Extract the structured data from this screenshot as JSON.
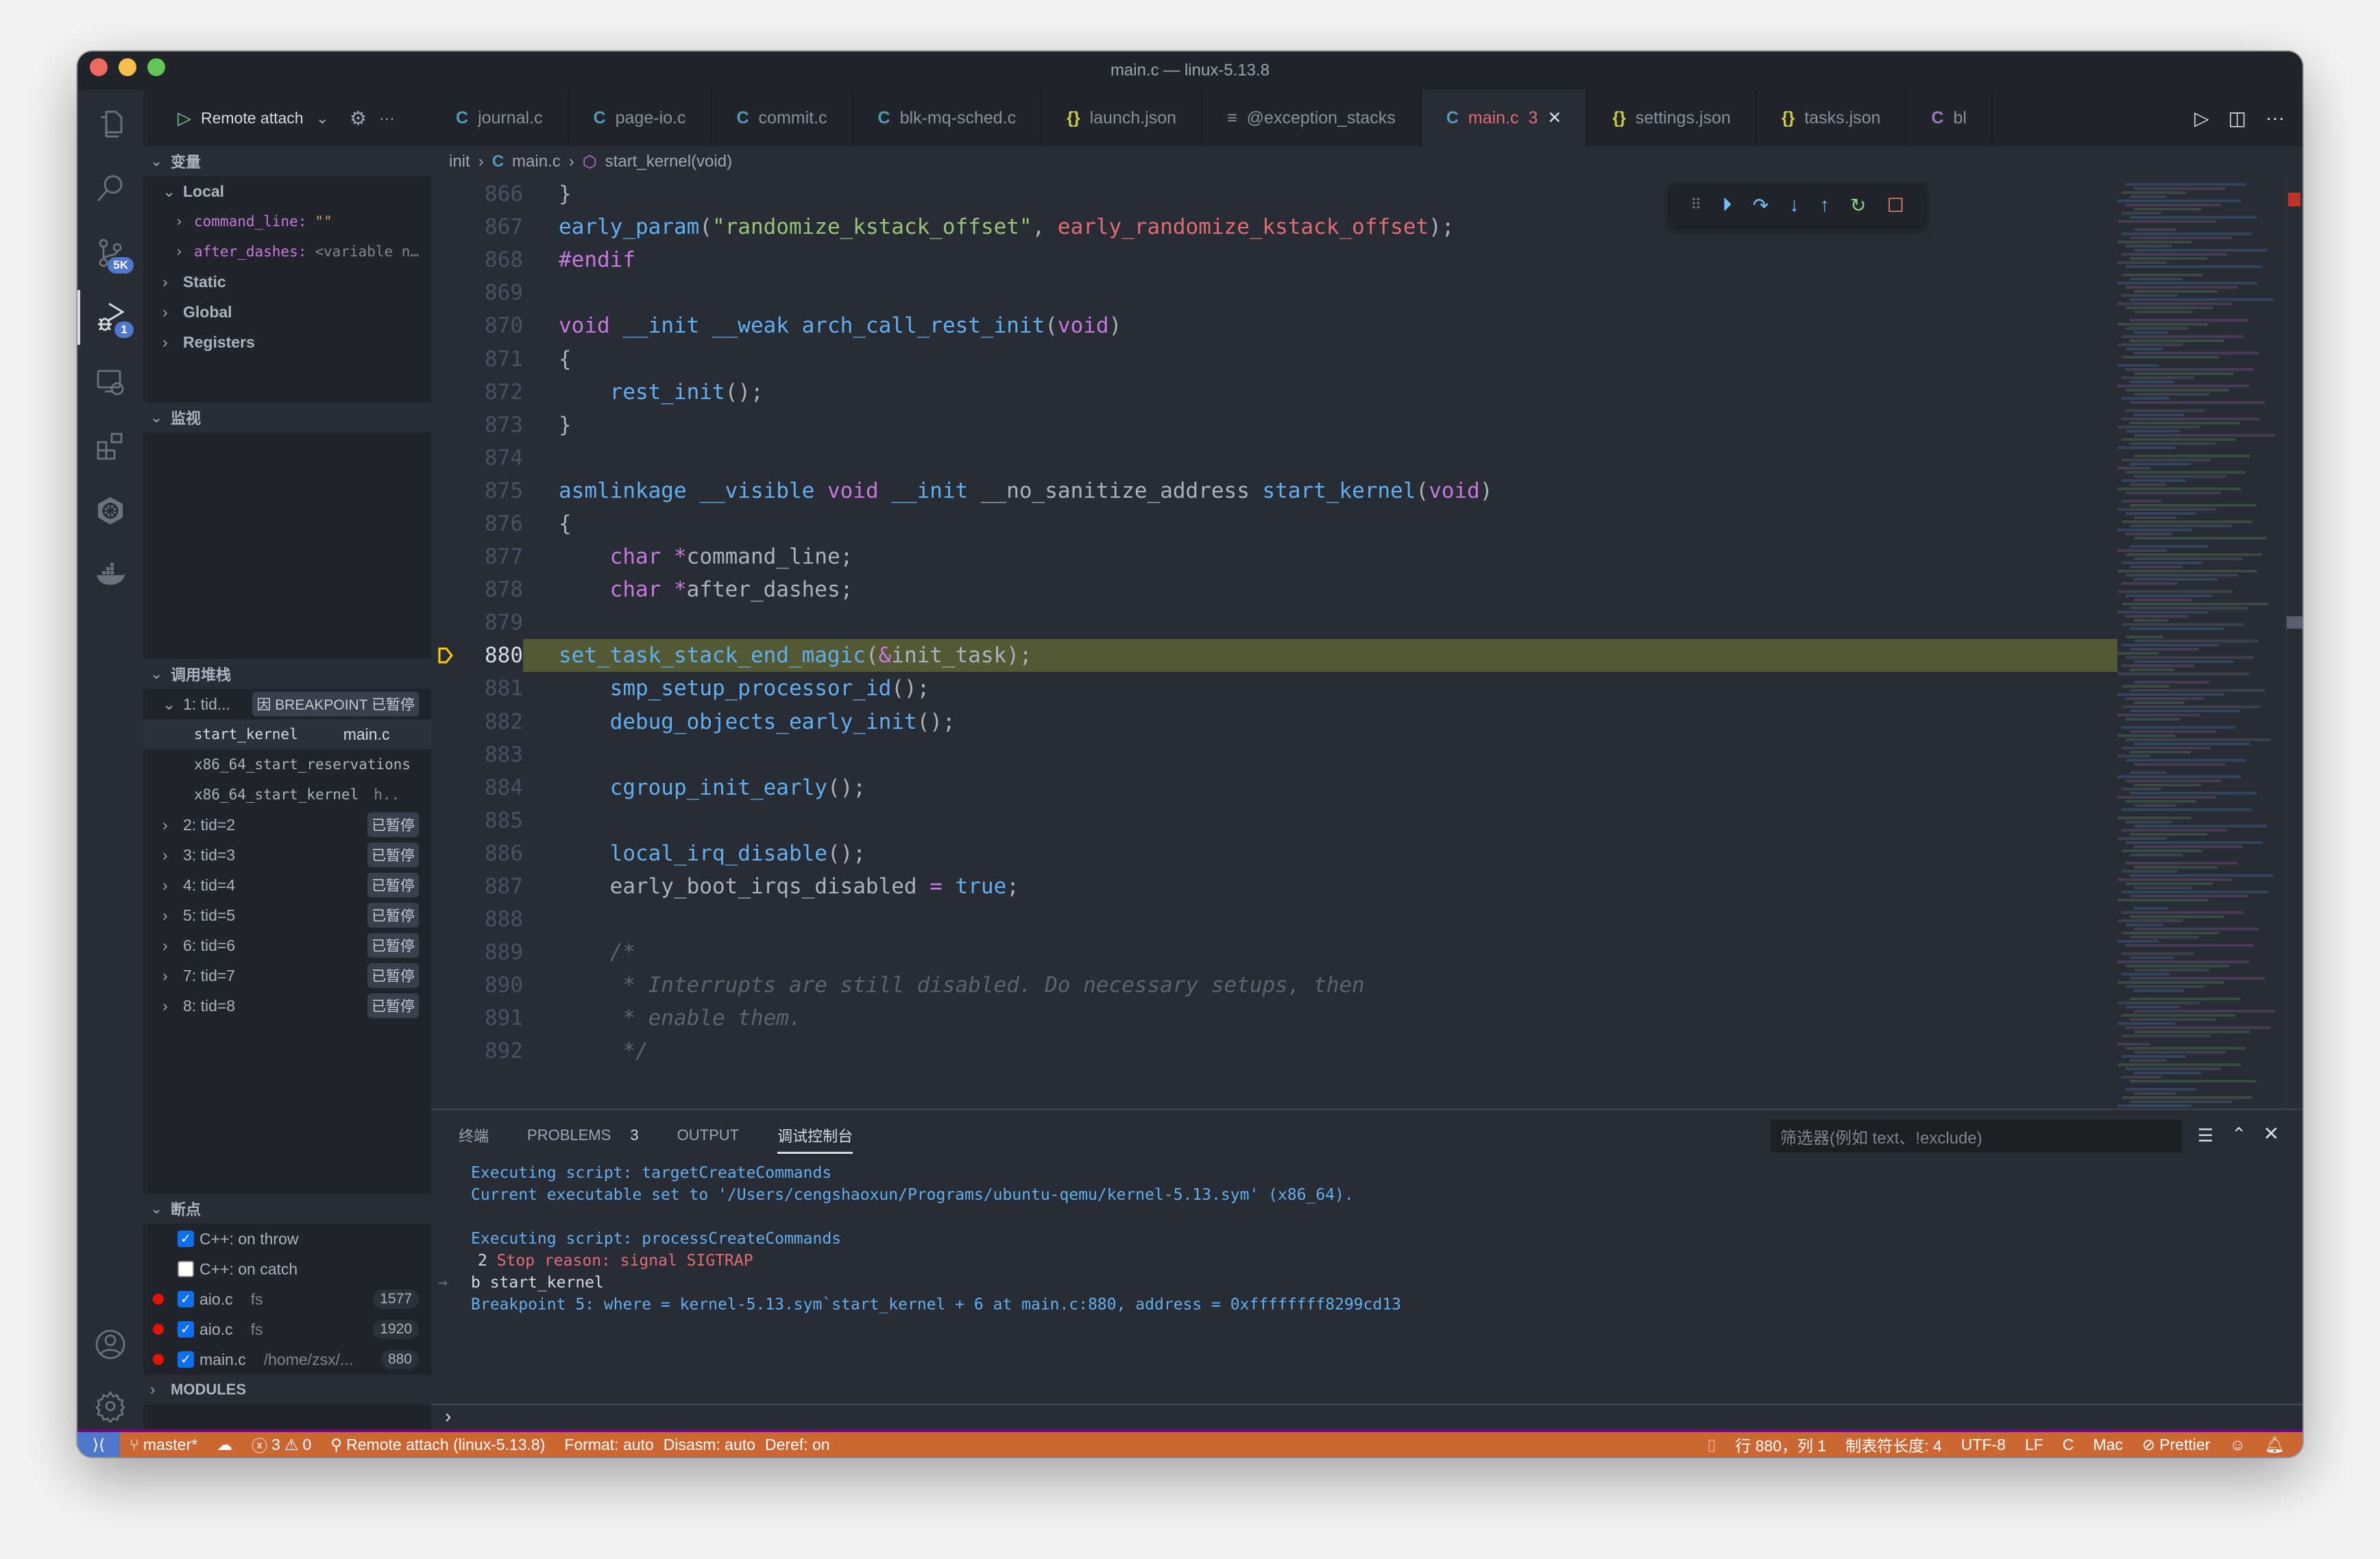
{
  "window": {
    "title": "main.c — linux-5.13.8"
  },
  "activity_bar": {
    "items": [
      {
        "name": "explorer",
        "badge": null
      },
      {
        "name": "search",
        "badge": null
      },
      {
        "name": "source-control",
        "badge": "5K"
      },
      {
        "name": "run-debug",
        "badge": "1",
        "active": true
      },
      {
        "name": "remote-explorer",
        "badge": null
      },
      {
        "name": "extensions",
        "badge": null
      },
      {
        "name": "kubernetes",
        "badge": null
      },
      {
        "name": "docker",
        "badge": null
      }
    ],
    "bottom": [
      "accounts",
      "manage"
    ]
  },
  "debug_header": {
    "config": "Remote attach"
  },
  "variables": {
    "title": "变量",
    "local_label": "Local",
    "locals": [
      {
        "name": "command_line:",
        "value": "\"\""
      },
      {
        "name": "after_dashes:",
        "value": "<variable n…"
      }
    ],
    "scopes": [
      "Static",
      "Global",
      "Registers"
    ]
  },
  "watch": {
    "title": "监视"
  },
  "callstack": {
    "title": "调用堆栈",
    "thread1": {
      "label": "1: tid...",
      "status": "因 BREAKPOINT 已暂停"
    },
    "frames": [
      {
        "name": "start_kernel",
        "file": "main.c"
      },
      {
        "name": "x86_64_start_reservations",
        "file": ""
      },
      {
        "name": "x86_64_start_kernel",
        "file": "h.."
      }
    ],
    "threads": [
      {
        "label": "2: tid=2",
        "status": "已暂停"
      },
      {
        "label": "3: tid=3",
        "status": "已暂停"
      },
      {
        "label": "4: tid=4",
        "status": "已暂停"
      },
      {
        "label": "5: tid=5",
        "status": "已暂停"
      },
      {
        "label": "6: tid=6",
        "status": "已暂停"
      },
      {
        "label": "7: tid=7",
        "status": "已暂停"
      },
      {
        "label": "8: tid=8",
        "status": "已暂停"
      }
    ]
  },
  "breakpoints": {
    "title": "断点",
    "items": [
      {
        "label": "C++: on throw",
        "path": "",
        "line": "",
        "checked": true,
        "dot": false
      },
      {
        "label": "C++: on catch",
        "path": "",
        "line": "",
        "checked": false,
        "dot": false
      },
      {
        "label": "aio.c",
        "path": "fs",
        "line": "1577",
        "checked": true,
        "dot": true
      },
      {
        "label": "aio.c",
        "path": "fs",
        "line": "1920",
        "checked": true,
        "dot": true
      },
      {
        "label": "main.c",
        "path": "/home/zsx/...",
        "line": "880",
        "checked": true,
        "dot": true
      }
    ]
  },
  "modules": {
    "title": "MODULES"
  },
  "tabs": [
    {
      "icon": "C",
      "label": "journal.c"
    },
    {
      "icon": "C",
      "label": "page-io.c"
    },
    {
      "icon": "C",
      "label": "commit.c"
    },
    {
      "icon": "C",
      "label": "blk-mq-sched.c"
    },
    {
      "icon": "{}",
      "label": "launch.json"
    },
    {
      "icon": "≡",
      "label": "@exception_stacks"
    },
    {
      "icon": "C",
      "label": "main.c",
      "problems": "3",
      "active": true
    },
    {
      "icon": "{}",
      "label": "settings.json"
    },
    {
      "icon": "{}",
      "label": "tasks.json"
    },
    {
      "icon": "C",
      "label": "bl"
    }
  ],
  "breadcrumb": [
    "init",
    "main.c",
    "start_kernel(void)"
  ],
  "code": {
    "current_line": 880,
    "lines": [
      {
        "n": "866",
        "html": "}"
      },
      {
        "n": "867",
        "html": "<span class='f'>early_param</span>(<span class='s'>\"randomize_kstack_offset\"</span>, <span class='r'>early_randomize_kstack_offset</span>);"
      },
      {
        "n": "868",
        "html": "<span class='k'>#endif</span>"
      },
      {
        "n": "869",
        "html": ""
      },
      {
        "n": "870",
        "html": "<span class='k'>void</span> <span class='f'>__init</span> <span class='f'>__weak</span> <span class='f'>arch_call_rest_init</span>(<span class='k'>void</span>)"
      },
      {
        "n": "871",
        "html": "{"
      },
      {
        "n": "872",
        "html": "    <span class='f'>rest_init</span>();"
      },
      {
        "n": "873",
        "html": "}"
      },
      {
        "n": "874",
        "html": ""
      },
      {
        "n": "875",
        "html": "<span class='f'>asmlinkage</span> <span class='f'>__visible</span> <span class='k'>void</span> <span class='f'>__init</span> __no_sanitize_address <span class='f'>start_kernel</span>(<span class='k'>void</span>)"
      },
      {
        "n": "876",
        "html": "{"
      },
      {
        "n": "877",
        "html": "    <span class='k'>char</span> <span class='k'>*</span>command_line;"
      },
      {
        "n": "878",
        "html": "    <span class='k'>char</span> <span class='k'>*</span>after_dashes;"
      },
      {
        "n": "879",
        "html": ""
      },
      {
        "n": "880",
        "html": "    <span class='f'>set_task_stack_end_magic</span>(<span class='k'>&amp;</span>init_task);"
      },
      {
        "n": "881",
        "html": "    <span class='f'>smp_setup_processor_id</span>();"
      },
      {
        "n": "882",
        "html": "    <span class='f'>debug_objects_early_init</span>();"
      },
      {
        "n": "883",
        "html": ""
      },
      {
        "n": "884",
        "html": "    <span class='f'>cgroup_init_early</span>();"
      },
      {
        "n": "885",
        "html": ""
      },
      {
        "n": "886",
        "html": "    <span class='f'>local_irq_disable</span>();"
      },
      {
        "n": "887",
        "html": "    early_boot_irqs_disabled <span class='k'>=</span> <span class='f'>true</span>;"
      },
      {
        "n": "888",
        "html": ""
      },
      {
        "n": "889",
        "html": "    <span class='c'>/*</span>"
      },
      {
        "n": "890",
        "html": "<span class='c'>     * Interrupts are still disabled. Do necessary setups, then</span>"
      },
      {
        "n": "891",
        "html": "<span class='c'>     * enable them.</span>"
      },
      {
        "n": "892",
        "html": "<span class='c'>     */</span>"
      }
    ]
  },
  "panel": {
    "tabs": [
      {
        "label": "终端"
      },
      {
        "label": "PROBLEMS",
        "count": "3"
      },
      {
        "label": "OUTPUT"
      },
      {
        "label": "调试控制台",
        "active": true
      }
    ],
    "filter_placeholder": "筛选器(例如 text、!exclude)",
    "console": [
      {
        "text": "Executing script: targetCreateCommands",
        "color": "#61afef"
      },
      {
        "text": "Current executable set to '/Users/cengshaoxun/Programs/ubuntu-qemu/kernel-5.13.sym' (x86_64).",
        "color": "#61afef"
      },
      {
        "text": "",
        "color": "#61afef"
      },
      {
        "text": "Executing script: processCreateCommands",
        "color": "#61afef"
      },
      {
        "text": "2",
        "suffix": "Stop reason: signal SIGTRAP",
        "color": "#d7dae0",
        "suffix_color": "#e06c75"
      },
      {
        "text": "b start_kernel",
        "color": "#d7dae0",
        "input": true
      },
      {
        "text": "Breakpoint 5: where = kernel-5.13.sym`start_kernel + 6 at main.c:880, address = 0xffffffff8299cd13",
        "color": "#61afef"
      }
    ]
  },
  "statusbar": {
    "branch": "master*",
    "errors": "3",
    "warnings": "0",
    "debug": "Remote attach (linux-5.13.8)",
    "format": "Format: auto",
    "disasm": "Disasm: auto",
    "deref": "Deref: on",
    "position": "行 880，列 1",
    "tab_size": "制表符长度: 4",
    "encoding": "UTF-8",
    "eol": "LF",
    "language": "C",
    "platform": "Mac",
    "prettier": "Prettier",
    "colors": {
      "background": "#cc6633",
      "remote": "#4d78cc",
      "border": "#6c0b7a"
    }
  }
}
